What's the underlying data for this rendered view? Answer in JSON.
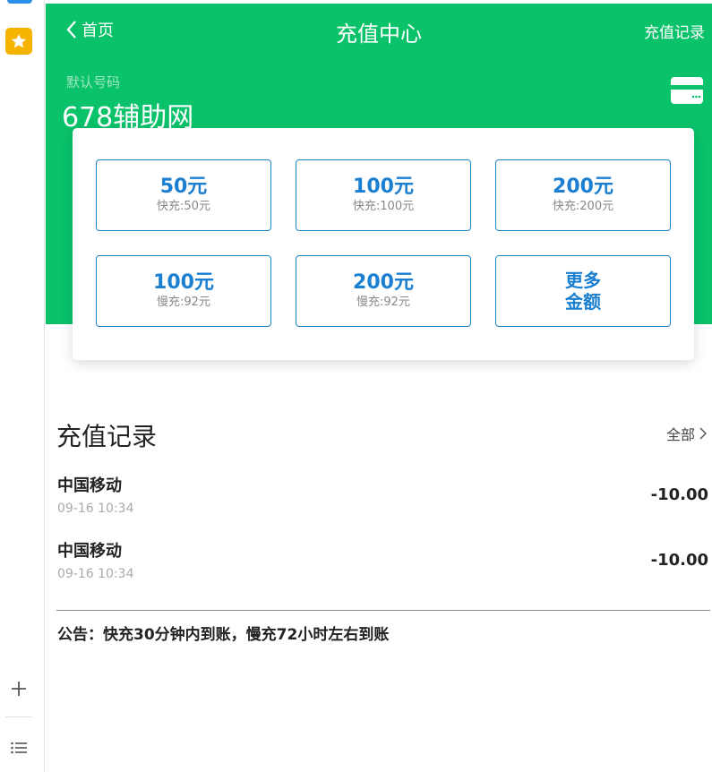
{
  "header": {
    "back_label": "首页",
    "title": "充值中心",
    "records_link": "充值记录"
  },
  "account": {
    "label": "默认号码",
    "value": "678辅助网"
  },
  "options": [
    {
      "amount": "50元",
      "sub": "快充:50元"
    },
    {
      "amount": "100元",
      "sub": "快充:100元"
    },
    {
      "amount": "200元",
      "sub": "快充:200元"
    },
    {
      "amount": "100元",
      "sub": "慢充:92元"
    },
    {
      "amount": "200元",
      "sub": "慢充:92元"
    }
  ],
  "more_option": {
    "line1": "更多",
    "line2": "金额"
  },
  "records": {
    "title": "充值记录",
    "all_label": "全部",
    "items": [
      {
        "name": "中国移动",
        "time": "09-16 10:34",
        "amount": "-10.00"
      },
      {
        "name": "中国移动",
        "time": "09-16 10:34",
        "amount": "-10.00"
      }
    ]
  },
  "notice": "公告：快充30分钟内到账，慢充72小时左右到账",
  "colors": {
    "brand_green": "#0ac26a",
    "accent_blue": "#1a7fd0",
    "border_blue": "#1a84c6"
  },
  "icons": {
    "back": "chevron-left-icon",
    "card": "card-icon",
    "all": "chevron-right-icon",
    "star": "star-icon",
    "plus": "plus-icon",
    "list": "list-icon"
  }
}
